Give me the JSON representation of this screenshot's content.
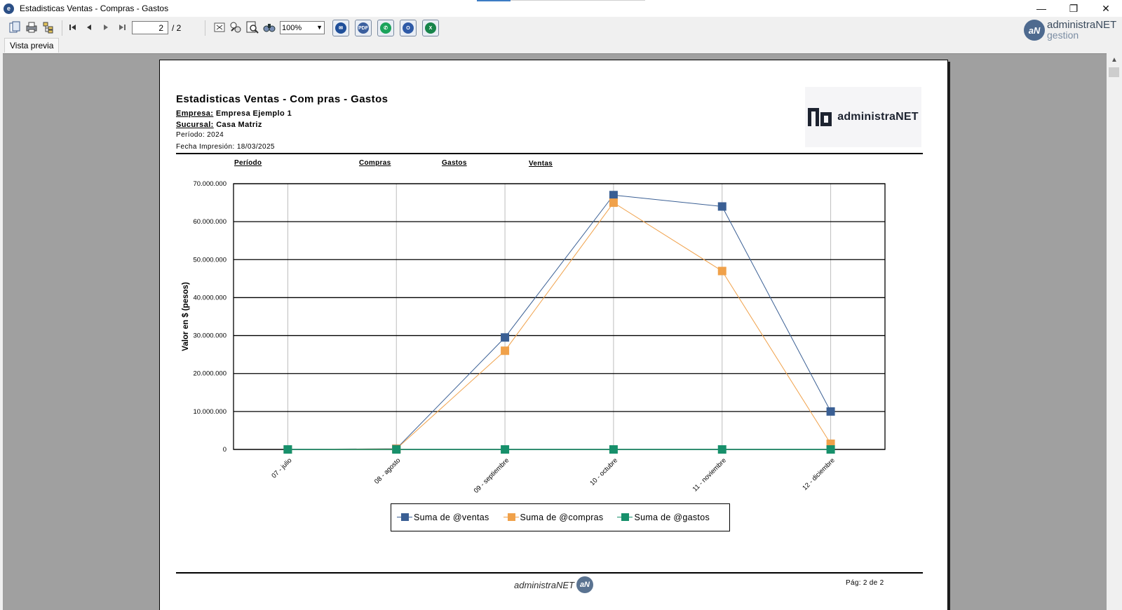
{
  "window": {
    "title": "Estadisticas Ventas - Compras - Gastos",
    "minimize": "—",
    "restore": "❐",
    "close": "✕"
  },
  "toolbar": {
    "page_current": "2",
    "page_total": "/ 2",
    "zoom": "100%",
    "export_buttons": [
      {
        "name": "email",
        "color": "#1f4f9a",
        "glyph": "✉"
      },
      {
        "name": "pdf",
        "color": "#3b5f9e",
        "glyph": "PDF"
      },
      {
        "name": "whatsapp",
        "color": "#1aa35b",
        "glyph": "✆"
      },
      {
        "name": "outlook",
        "color": "#2e5aa7",
        "glyph": "O"
      },
      {
        "name": "excel",
        "color": "#17844a",
        "glyph": "X"
      }
    ]
  },
  "brand": {
    "line1": "administraNET",
    "line2": "gestion",
    "mark": "aN"
  },
  "tabs": {
    "preview": "Vista previa"
  },
  "report": {
    "title": "Estadisticas Ventas - Com pras - Gastos",
    "empresa_label": "Empresa:",
    "empresa_value": "Empresa Ejemplo 1",
    "sucursal_label": "Sucursal:",
    "sucursal_value": "Casa Matriz",
    "periodo": "Período: 2024",
    "fecha": "Fecha Impresión: 18/03/2025",
    "logo_text": "administraNET",
    "columns": [
      "Período",
      "Compras",
      "Gastos",
      "Ventas"
    ],
    "footer_brand": "administraNET",
    "page_label": "Pág: 2 de 2"
  },
  "chart_data": {
    "type": "line",
    "title": "",
    "xlabel": "",
    "ylabel": "Valor en $ (pesos)",
    "ylim": [
      0,
      70000000
    ],
    "yticks": [
      "70.000.000",
      "60.000.000",
      "50.000.000",
      "40.000.000",
      "30.000.000",
      "20.000.000",
      "10.000.000",
      "0"
    ],
    "ytick_values": [
      70000000,
      60000000,
      50000000,
      40000000,
      30000000,
      20000000,
      10000000,
      0
    ],
    "categories": [
      "07 - julio",
      "08 - agosto",
      "09 - septiembre",
      "10 - octubre",
      "11 - noviembre",
      "12 - diciembre"
    ],
    "grid": true,
    "legend_position": "bottom",
    "series": [
      {
        "name": "Suma de @ventas",
        "color": "#3a5f94",
        "values": [
          0,
          200000,
          29500000,
          67000000,
          64000000,
          10000000
        ]
      },
      {
        "name": "Suma de @compras",
        "color": "#f0a14a",
        "values": [
          0,
          150000,
          26000000,
          65000000,
          47000000,
          1500000
        ]
      },
      {
        "name": "Suma de @gastos",
        "color": "#17906b",
        "values": [
          0,
          0,
          0,
          0,
          0,
          0
        ]
      }
    ]
  }
}
